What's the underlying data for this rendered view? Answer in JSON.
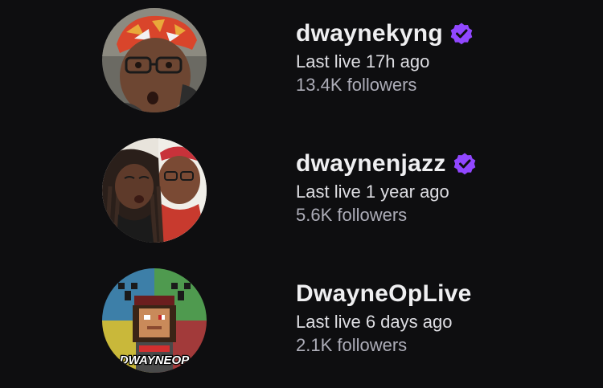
{
  "channels": [
    {
      "name": "dwaynekyng",
      "verified": true,
      "last_live": "Last live 17h ago",
      "followers": "13.4K followers",
      "avatar_icon": "avatar-photo"
    },
    {
      "name": "dwaynenjazz",
      "verified": true,
      "last_live": "Last live 1 year ago",
      "followers": "5.6K followers",
      "avatar_icon": "avatar-photo"
    },
    {
      "name": "DwayneOpLive",
      "verified": false,
      "last_live": "Last live 6 days ago",
      "followers": "2.1K followers",
      "avatar_icon": "avatar-pixel-art",
      "avatar_text": "DWAYNEOP"
    }
  ],
  "colors": {
    "background": "#0e0e10",
    "verified": "#9147ff",
    "primary_text": "#efeff1",
    "secondary_text": "#adadb8"
  }
}
